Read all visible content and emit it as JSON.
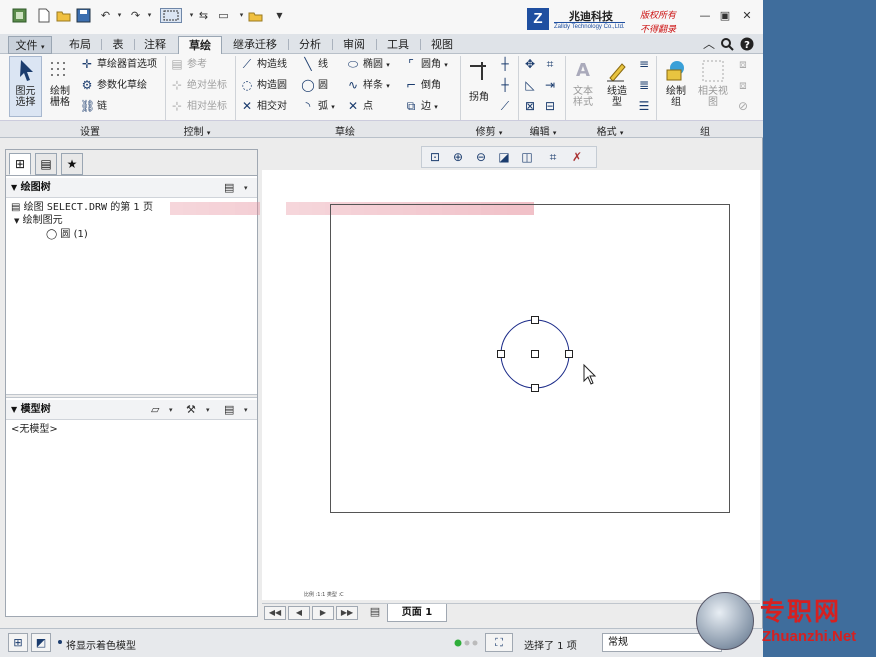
{
  "titlebar": {
    "brand_logo": "Z",
    "brand_name": "兆迪科技",
    "brand_sub": "Zalldy Technology Co.,Ltd.",
    "copyright_line1": "版权所有",
    "copyright_line2": "不得翻录"
  },
  "menu": {
    "file": "文件",
    "tabs": [
      "布局",
      "表",
      "注释",
      "草绘",
      "继承迁移",
      "分析",
      "审阅",
      "工具",
      "视图"
    ],
    "active_tab": "草绘"
  },
  "ribbon": {
    "settings": {
      "select_line1": "图元",
      "select_line2": "选择",
      "drawgrid_line1": "绘制",
      "drawgrid_line2": "栅格",
      "sketcher_prefs": "草绘器首选项",
      "parametric_sketch": "参数化草绘",
      "chain": "链"
    },
    "control": {
      "reference": "参考",
      "absolute_coord": "绝对坐标",
      "relative_coord": "相对坐标"
    },
    "sketch": {
      "construction_line": "构造线",
      "construction_circle": "构造圆",
      "intersect": "相交对",
      "line": "线",
      "circle": "圆",
      "arc": "弧",
      "ellipse": "椭圆",
      "spline": "样条",
      "point": "点",
      "fillet": "圆角",
      "chamfer": "倒角",
      "edge": "边"
    },
    "trim": {
      "corner": "拐角"
    },
    "format": {
      "text_style_line1": "文本",
      "text_style_line2": "样式",
      "line_style_line1": "线造",
      "line_style_line2": "型"
    },
    "group": {
      "draw_group_line1": "绘制",
      "draw_group_line2": "组",
      "related_view_line1": "相关视",
      "related_view_line2": "图"
    },
    "groups": [
      "设置",
      "控制",
      "草绘",
      "修剪",
      "编辑",
      "格式",
      "组"
    ]
  },
  "left_panel": {
    "drawing_tree_title": "绘图树",
    "drawing_prefix": "绘图",
    "drawing_file": "SELECT.DRW",
    "drawing_suffix": "的第 1 页",
    "draw_items_label": "绘制图元",
    "circle_item": "圆 (1)",
    "model_tree_title": "模型树",
    "no_model": "<无模型>"
  },
  "canvas": {
    "scale_note": "比例 :1:1  类型 :C"
  },
  "pagebar": {
    "page_label": "页面 1"
  },
  "status": {
    "message": "将显示着色模型",
    "selection": "选择了 1 项",
    "filter": "常规"
  },
  "watermark": {
    "cn": "专职网",
    "en": "Zhuanzhi.Net"
  },
  "colors": {
    "desktop": "#3f6d9c",
    "accent": "#1b3c6e",
    "circle_stroke": "#1a2a88",
    "blur_pink": "#e48a98",
    "watermark_red": "#d62020"
  }
}
